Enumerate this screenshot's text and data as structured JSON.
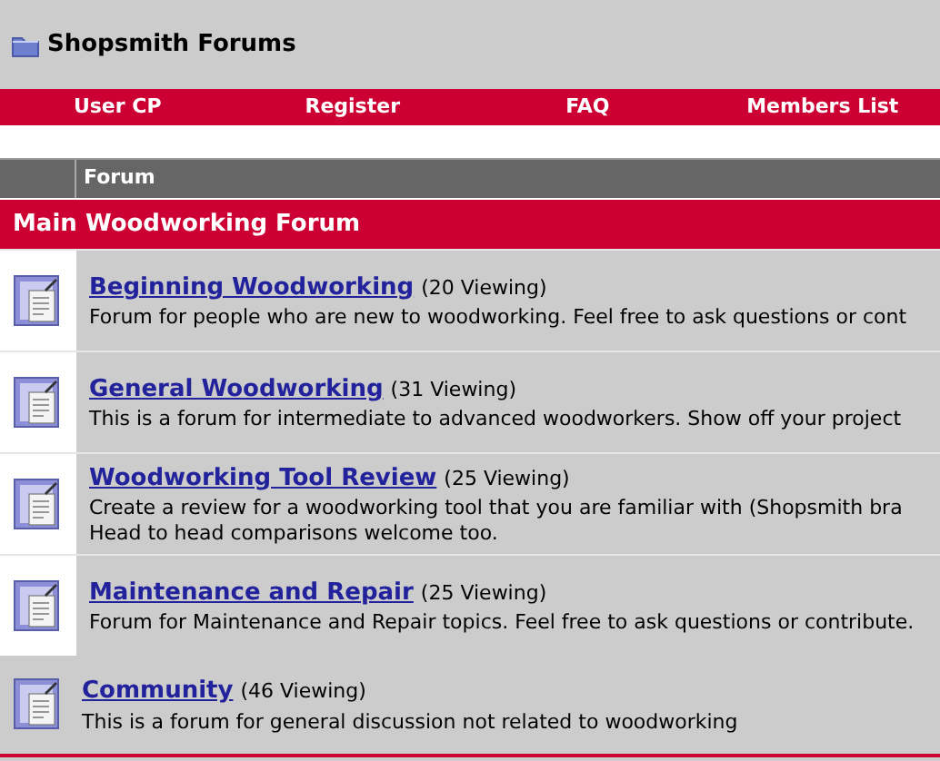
{
  "site_title": "Shopsmith Forums",
  "nav": [
    "User CP",
    "Register",
    "FAQ",
    "Members List"
  ],
  "table_header": {
    "column_2": "Forum"
  },
  "section": {
    "title": "Main Woodworking Forum",
    "forums": [
      {
        "name": "Beginning Woodworking",
        "viewing": "(20 Viewing)",
        "description": [
          "Forum for people who are new to woodworking. Feel free to ask questions or cont"
        ]
      },
      {
        "name": "General Woodworking",
        "viewing": "(31 Viewing)",
        "description": [
          "This is a forum for intermediate to advanced woodworkers. Show off your project"
        ]
      },
      {
        "name": "Woodworking Tool Review",
        "viewing": "(25 Viewing)",
        "description": [
          "Create a review for a woodworking tool that you are familiar with (Shopsmith bra",
          "Head to head comparisons welcome too."
        ]
      },
      {
        "name": "Maintenance and Repair",
        "viewing": "(25 Viewing)",
        "description": [
          "Forum for Maintenance and Repair topics. Feel free to ask questions or contribute."
        ]
      }
    ]
  },
  "category": {
    "name": "Community",
    "viewing": "(46 Viewing)",
    "description": "This is a forum for general discussion not related to woodworking"
  }
}
